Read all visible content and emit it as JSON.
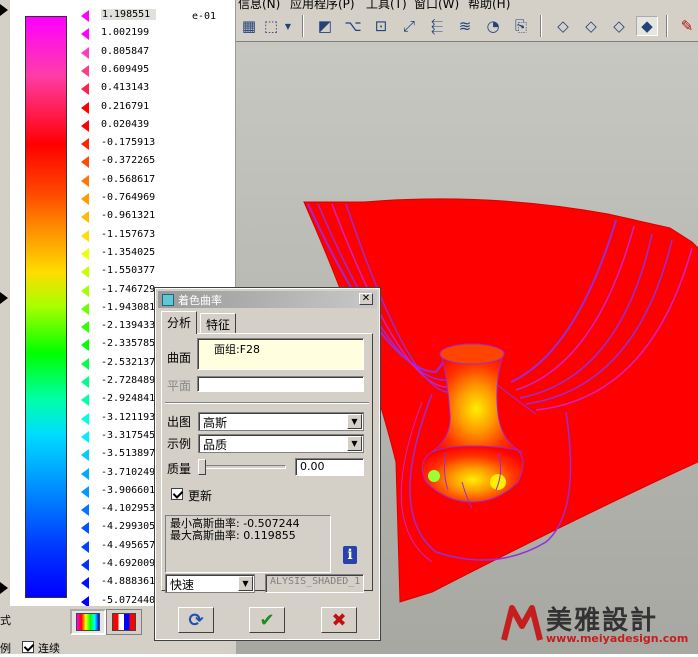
{
  "menu": {
    "items": [
      "信息(N)",
      "应用程序(P)",
      "工具(T)",
      "窗口(W)",
      "帮助(H)"
    ]
  },
  "toolbar": {
    "icons": [
      "datum-display-icon",
      "datum-axis-icon",
      "zoom-icon",
      "repaint-icon",
      "orient-icon",
      "layer-icon",
      "saved-view-icon",
      "view-manager-icon",
      "wireframe-icon",
      "hidden-line-icon",
      "no-hidden-icon",
      "shading-icon",
      "sketch-icon"
    ]
  },
  "legend": {
    "exponent": "e-01",
    "values": [
      "1.198551",
      "1.002199",
      "0.805847",
      "0.609495",
      "0.413143",
      "0.216791",
      "0.020439",
      "-0.175913",
      "-0.372265",
      "-0.568617",
      "-0.764969",
      "-0.961321",
      "-1.157673",
      "-1.354025",
      "-1.550377",
      "-1.746729",
      "-1.943081",
      "-2.139433",
      "-2.335785",
      "-2.532137",
      "-2.728489",
      "-2.924841",
      "-3.121193",
      "-3.317545",
      "-3.513897",
      "-3.710249",
      "-3.906601",
      "-4.102953",
      "-4.299305",
      "-4.495657",
      "-4.692009",
      "-4.888361",
      "-5.072440"
    ],
    "tick_colors": [
      "#ff00ff",
      "#ff00ff",
      "#ff3dbb",
      "#ff3d86",
      "#ff2050",
      "#ff0000",
      "#ff0000",
      "#ff2200",
      "#ff4a00",
      "#ff7700",
      "#ff9a00",
      "#ffbb00",
      "#ffdd00",
      "#eeff00",
      "#c6ff00",
      "#a6ff00",
      "#6fff00",
      "#30ff00",
      "#00ff00",
      "#00ff44",
      "#00ff88",
      "#00ffaa",
      "#00ffdd",
      "#00eeff",
      "#00ccff",
      "#00aaff",
      "#0099ff",
      "#0077ff",
      "#0055ff",
      "#0044ff",
      "#0033ff",
      "#0011ff",
      "#0000ff"
    ]
  },
  "bottom_left": {
    "mode_label": "式",
    "scale_label": "例",
    "continuous_label": "连续",
    "continuous_checked": true
  },
  "dialog": {
    "title": "着色曲率",
    "tabs": [
      "分析",
      "特征"
    ],
    "surface_label": "曲面",
    "surface_value": "面组:F28",
    "plane_label": "平面",
    "plane_value": "",
    "output_label": "出图",
    "output_value": "高斯",
    "sample_label": "示例",
    "sample_value": "品质",
    "quality_label": "质量",
    "quality_value": "0.00",
    "quality_slider_fraction": 0.0,
    "update_label": "更新",
    "update_checked": true,
    "info_line1": "最小高斯曲率: -0.507244",
    "info_line2": "最大高斯曲率: 0.119855",
    "speed_value": "快速",
    "analysis_name": "ALYSIS_SHADED_1",
    "buttons": [
      "repeat-icon",
      "ok-icon",
      "cancel-icon"
    ]
  },
  "watermark": {
    "text": "美雅設計",
    "url": "www.meiyadesign.com"
  }
}
